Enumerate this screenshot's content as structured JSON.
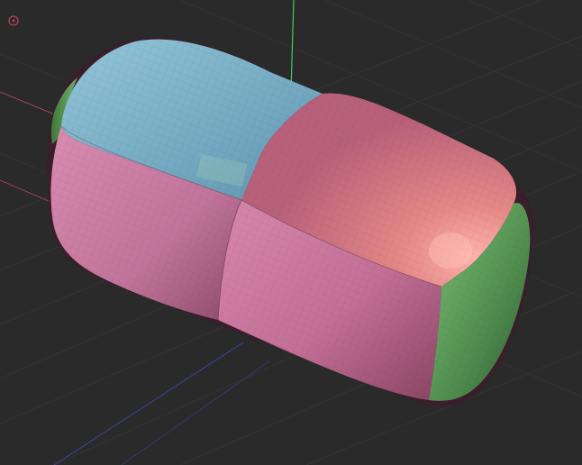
{
  "viewport": {
    "background": "#2a2a2a",
    "grid_color": "#353535",
    "axes": {
      "x_color": "#b0405a",
      "y_color": "#3fcf5a",
      "z_color": "#3a3f8a"
    },
    "gizmo_icon": "origin-circle-icon"
  },
  "mesh": {
    "shape": "rounded-box",
    "face_colors": {
      "top_left": "#7fb3c9",
      "top_right": "#d7787c",
      "front_left": "#cc7aa0",
      "front_right": "#cc77a2",
      "side_end": "#5e9a5c"
    },
    "highlight_color": "#ffb0a8",
    "edge_shadow": "#5a2a3c"
  }
}
